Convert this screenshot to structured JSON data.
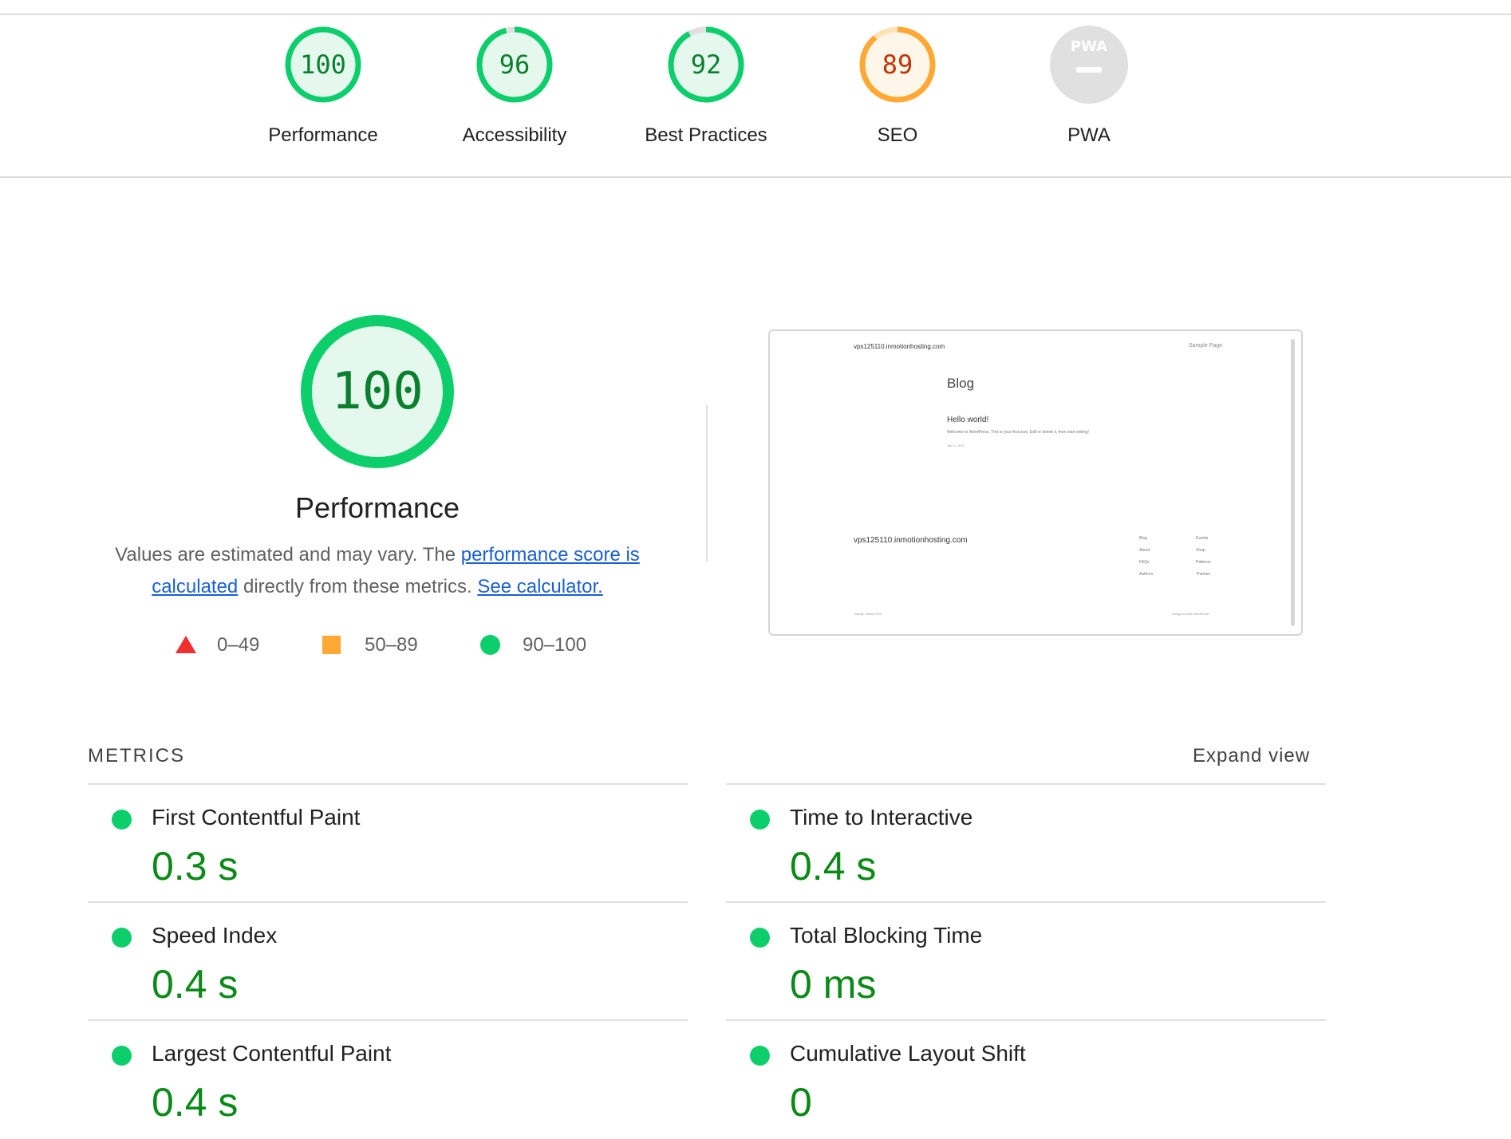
{
  "summary_gauges": [
    {
      "label": "Performance",
      "score": "100",
      "value": 100,
      "rating": "pass",
      "color": "#0cce6b",
      "bg": "#e5f8ed",
      "text_color": "#0a7f2e"
    },
    {
      "label": "Accessibility",
      "score": "96",
      "value": 96,
      "rating": "pass",
      "color": "#0cce6b",
      "bg": "#e5f8ed",
      "text_color": "#0a7f2e"
    },
    {
      "label": "Best Practices",
      "score": "92",
      "value": 92,
      "rating": "pass",
      "color": "#0cce6b",
      "bg": "#e5f8ed",
      "text_color": "#0a7f2e"
    },
    {
      "label": "SEO",
      "score": "89",
      "value": 89,
      "rating": "average",
      "color": "#ffa834",
      "bg": "#fff6ea",
      "text_color": "#c33300"
    },
    {
      "label": "PWA",
      "badge_text": "PWA",
      "rating": "na"
    }
  ],
  "performance": {
    "score": "100",
    "value": 100,
    "title": "Performance",
    "desc_part1": "Values are estimated and may vary. The ",
    "desc_link1": "performance score is calculated",
    "desc_part2": " directly from these metrics. ",
    "desc_link2": "See calculator."
  },
  "legend": [
    {
      "shape": "triangle",
      "range": "0–49",
      "color": "#f0302f"
    },
    {
      "shape": "square",
      "range": "50–89",
      "color": "#ffa834"
    },
    {
      "shape": "circle",
      "range": "90–100",
      "color": "#0cce6b"
    }
  ],
  "screenshot_preview": {
    "site_name": "vps125110.inmotionhosting.com",
    "nav_link": "Sample Page",
    "heading": "Blog",
    "post_title": "Hello world!",
    "post_excerpt": "Welcome to WordPress. This is your first post. Edit or delete it, then start writing!",
    "post_date": "July 2, 2024",
    "footer_site": "vps125110.inmotionhosting.com",
    "footer_links_col1": [
      "Blog",
      "About",
      "FAQs",
      "Authors"
    ],
    "footer_links_col2": [
      "Events",
      "Shop",
      "Patterns",
      "Themes"
    ],
    "footer_theme": "Twenty Twenty-Five",
    "footer_credit": "Designed with WordPress"
  },
  "metrics": {
    "heading": "METRICS",
    "expand_label": "Expand view",
    "items": [
      {
        "name": "First Contentful Paint",
        "value": "0.3 s",
        "rating": "pass"
      },
      {
        "name": "Time to Interactive",
        "value": "0.4 s",
        "rating": "pass"
      },
      {
        "name": "Speed Index",
        "value": "0.4 s",
        "rating": "pass"
      },
      {
        "name": "Total Blocking Time",
        "value": "0 ms",
        "rating": "pass"
      },
      {
        "name": "Largest Contentful Paint",
        "value": "0.4 s",
        "rating": "pass"
      },
      {
        "name": "Cumulative Layout Shift",
        "value": "0",
        "rating": "pass"
      }
    ]
  }
}
